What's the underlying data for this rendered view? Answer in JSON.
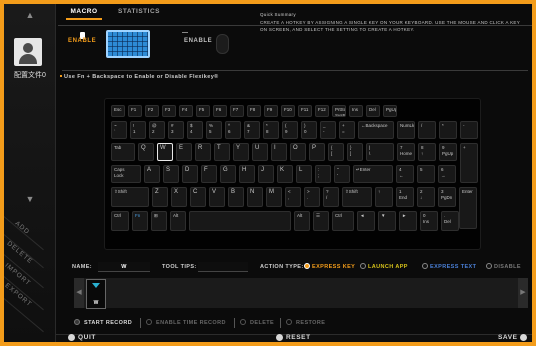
{
  "tabs": [
    {
      "label": "MACRO",
      "active": true
    },
    {
      "label": "STATISTICS",
      "active": false
    }
  ],
  "sidebar": {
    "profile_name": "配置文件0",
    "actions": [
      "ADD",
      "DELETE",
      "IMPORT",
      "EXPORT"
    ]
  },
  "header": {
    "enable_left": "ENABLE",
    "enable_mid": "ENABLE",
    "desc_title": "Quick Summary",
    "desc_text": "Create a hotkey by assigning a single key on your keyboard. Use the mouse and click a key on screen, and select the setting to create a hotkey.",
    "hint": "Use Fn + Backspace to Enable or Disable Flexikey®"
  },
  "options": {
    "name_label": "NAME:",
    "name_value": "W",
    "tooltips_label": "TOOL TIPS:",
    "tooltips_value": "",
    "action_type_label": "ACTION TYPE:",
    "express_key": "EXPRESS KEY",
    "launch_app": "LAUNCH APP",
    "express_text": "EXPRESS TEXT",
    "disable": "DISABLE"
  },
  "macro_item_label": "W",
  "record": {
    "start": "START RECORD",
    "enable_time": "ENABLE TIME RECORD",
    "delete": "DELETE",
    "restore": "RESTORE"
  },
  "bottom": {
    "quit": "QUIT",
    "reset": "RESET",
    "save": "SAVE"
  },
  "colors": {
    "accent": "#f39c1a",
    "express_text": "#4a7fd6",
    "launch_app": "#d6c21a",
    "express_key": "#f39c1a"
  },
  "keyboard": {
    "rows": [
      [
        "Esc",
        "F1",
        "F2",
        "F3",
        "F4",
        "F5",
        "F6",
        "F7",
        "F8",
        "F9",
        "F10",
        "F11",
        "F12",
        "PrtSc SysRq",
        "Ins",
        "Del",
        "PgUp"
      ],
      [
        "~ `",
        "! 1",
        "@ 2",
        "# 3",
        "$ 4",
        "% 5",
        "^ 6",
        "& 7",
        "* 8",
        "( 9",
        ") 0",
        "_ -",
        "+ =",
        "←Backspace",
        "NumLk",
        "/",
        "*",
        "-"
      ],
      [
        "Tab",
        "Q",
        "W",
        "E",
        "R",
        "T",
        "Y",
        "U",
        "I",
        "O",
        "P",
        "{ [",
        "} ]",
        "| \\",
        "7 Home",
        "8 ↑",
        "9 PgUp",
        "+"
      ],
      [
        "Caps Lock",
        "A",
        "S",
        "D",
        "F",
        "G",
        "H",
        "J",
        "K",
        "L",
        ": ;",
        "\" '",
        "↵Enter",
        "4 ←",
        "5",
        "6 →"
      ],
      [
        "⇧Shift",
        "Z",
        "X",
        "C",
        "V",
        "B",
        "N",
        "M",
        "< ,",
        "> .",
        "? /",
        "⇧Shift",
        "↑",
        "1 End",
        "2 ↓",
        "3 PgDn",
        "Enter"
      ],
      [
        "Ctrl",
        "Fn",
        "⊞",
        "Alt",
        "",
        "Alt",
        "☰",
        "Ctrl",
        "◄",
        "▼",
        "►",
        "0 Ins",
        ". Del"
      ]
    ],
    "selected_key": "W"
  }
}
